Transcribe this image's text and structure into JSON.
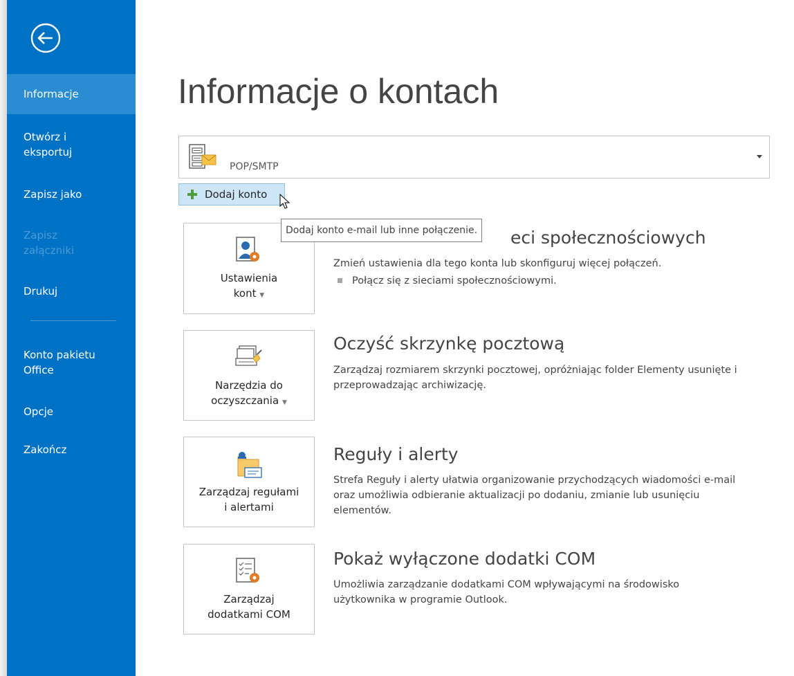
{
  "sidebar": {
    "items": [
      {
        "label": "Informacje",
        "active": true
      },
      {
        "label": "Otwórz i\neksportuj"
      },
      {
        "label": "Zapisz jako"
      },
      {
        "label": "Zapisz\nzałączniki",
        "disabled": true
      },
      {
        "label": "Drukuj"
      },
      {
        "label": "Konto pakietu\nOffice"
      },
      {
        "label": "Opcje"
      },
      {
        "label": "Zakończ"
      }
    ],
    "back_icon": "back-arrow-icon",
    "colors": {
      "background": "#0072c6",
      "active": "#2a8dd4"
    }
  },
  "main": {
    "title": "Informacje o kontach",
    "account": {
      "label": "POP/SMTP",
      "icon": "mail-server-icon"
    },
    "add_account": {
      "label": "Dodaj konto",
      "icon": "plus-icon"
    },
    "tooltip": "Dodaj konto e-mail lub inne połączenie.",
    "sections": [
      {
        "tile": {
          "line1": "Ustawienia",
          "line2": "kont",
          "has_dropdown": true,
          "icon": "account-settings-icon"
        },
        "title": "eci społecznościowych",
        "description": "Zmień ustawienia dla tego konta lub skonfiguruj więcej połączeń.",
        "bullet": "Połącz się z sieciami społecznościowymi."
      },
      {
        "tile": {
          "line1": "Narzędzia do",
          "line2": "oczyszczania",
          "has_dropdown": true,
          "icon": "cleanup-tools-icon"
        },
        "title": "Oczyść skrzynkę pocztową",
        "description": "Zarządzaj rozmiarem skrzynki pocztowej, opróżniając folder Elementy usunięte i przeprowadzając archiwizację."
      },
      {
        "tile": {
          "line1": "Zarządzaj regułami",
          "line2": "i alertami",
          "has_dropdown": false,
          "icon": "rules-alerts-icon"
        },
        "title": "Reguły i alerty",
        "description": "Strefa Reguły i alerty ułatwia organizowanie przychodzących wiadomości e-mail oraz umożliwia odbieranie aktualizacji po dodaniu, zmianie lub usunięciu elementów."
      },
      {
        "tile": {
          "line1": "Zarządzaj",
          "line2": "dodatkami COM",
          "has_dropdown": false,
          "icon": "com-addins-icon"
        },
        "title": "Pokaż wyłączone dodatki COM",
        "description": "Umożliwia zarządzanie dodatkami COM wpływającymi na środowisko użytkownika w programie Outlook."
      }
    ]
  }
}
